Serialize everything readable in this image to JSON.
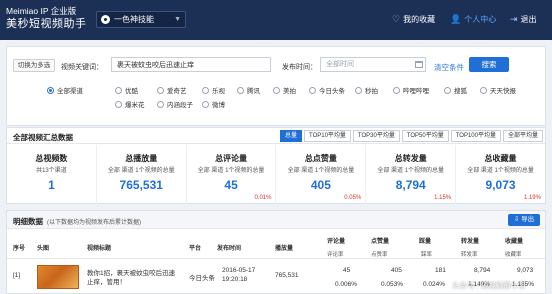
{
  "header": {
    "brand_en": "Meimiao IP 企业版",
    "brand_cn": "美秒短视频助手",
    "skill_label": "一色神技能",
    "favorites": "我的收藏",
    "user_center": "个人中心",
    "logout": "退出"
  },
  "filter": {
    "multi_select": "切换为多选",
    "keyword_label": "视频关键词：",
    "keyword_value": "裹天被蚊虫咬后迅速止痒",
    "date_label": "发布时间：",
    "date_placeholder": "全部时间",
    "clear": "清空条件",
    "search": "搜索",
    "channels": [
      "全部渠道",
      "优酷",
      "爱奇艺",
      "乐视",
      "腾讯",
      "美拍",
      "今日头条",
      "秒拍",
      "哔哩哔哩",
      "搜狐",
      "天天快报",
      "爆米花",
      "内涵段子",
      "微博"
    ],
    "selected_channel": "全部渠道"
  },
  "summary": {
    "title": "全部视频汇总数据",
    "tabs": [
      "总量",
      "TOP10平均量",
      "TOP30平均量",
      "TOP50平均量",
      "TOP100平均量",
      "全部平均量"
    ],
    "active_tab": "总量",
    "stats": [
      {
        "title": "总视频数",
        "sub": "共13个渠道",
        "value": "1",
        "pct": ""
      },
      {
        "title": "总播放量",
        "sub": "全部 渠道 1个视频的总量",
        "value": "765,531",
        "pct": ""
      },
      {
        "title": "总评论量",
        "sub": "全部 渠道 1个视频的总量",
        "value": "45",
        "pct": "0.01%"
      },
      {
        "title": "总点赞量",
        "sub": "全部 渠道 1个视频的总量",
        "value": "405",
        "pct": "0.05%"
      },
      {
        "title": "总转发量",
        "sub": "全部 渠道 1个视频的总量",
        "value": "8,794",
        "pct": "1.15%"
      },
      {
        "title": "总收藏量",
        "sub": "全部 渠道 1个视频的总量",
        "value": "9,073",
        "pct": "1.19%"
      }
    ]
  },
  "detail": {
    "title": "明细数据",
    "note": "(以下数据均为视频发布后累计数据)",
    "export": "导出",
    "columns": [
      "序号",
      "头图",
      "视频标题",
      "平台",
      "发布时间",
      "播放量",
      "评论量",
      "点赞量",
      "踩量",
      "转发量",
      "收藏量"
    ],
    "subcolumns": [
      "评论率",
      "点赞率",
      "踩率",
      "转发率",
      "收藏率"
    ],
    "rows": [
      {
        "index": "[1]",
        "title_line1": "教你1招，裹天被蚊虫咬后迅速",
        "title_line2": "止痒，管用！",
        "platform": "今日头条",
        "date": "2016-05-17",
        "time": "19:20:18",
        "plays": "765,531",
        "comments": "45",
        "likes": "405",
        "dislikes": "181",
        "shares": "8,794",
        "favorites": "9,073",
        "comment_rate": "0.006%",
        "like_rate": "0.053%",
        "dislike_rate": "0.024%",
        "share_rate": "1.149%",
        "fav_rate": "1.185%"
      }
    ]
  },
  "watermark": "头条号 / 短视频那小事"
}
